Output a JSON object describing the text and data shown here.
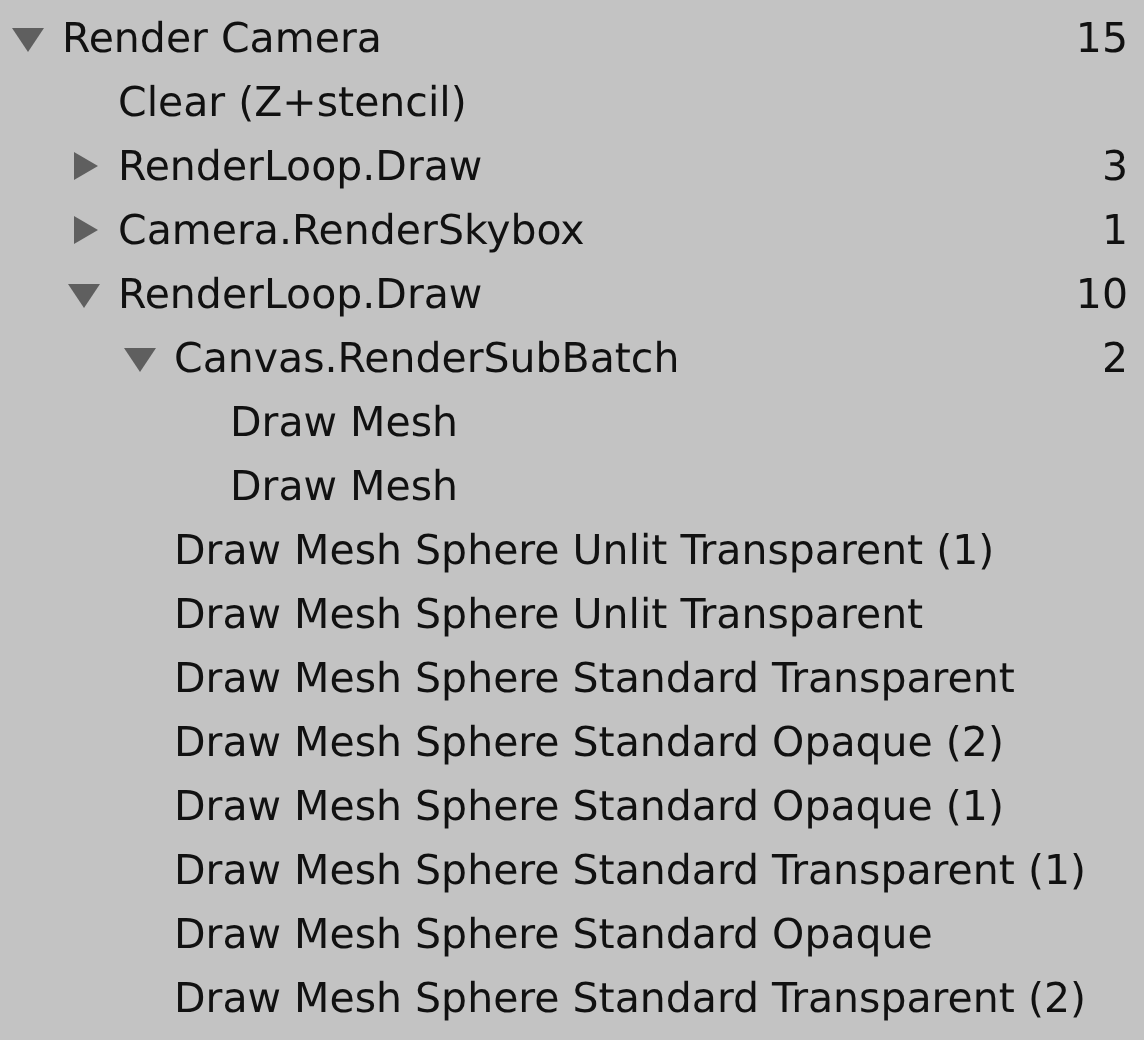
{
  "tree": [
    {
      "label": "Render Camera",
      "count": "15",
      "expanded": true,
      "children": [
        {
          "label": "Clear (Z+stencil)"
        },
        {
          "label": "RenderLoop.Draw",
          "count": "3",
          "expanded": false
        },
        {
          "label": "Camera.RenderSkybox",
          "count": "1",
          "expanded": false
        },
        {
          "label": "RenderLoop.Draw",
          "count": "10",
          "expanded": true,
          "children": [
            {
              "label": "Canvas.RenderSubBatch",
              "count": "2",
              "expanded": true,
              "children": [
                {
                  "label": "Draw Mesh"
                },
                {
                  "label": "Draw Mesh"
                }
              ]
            },
            {
              "label": "Draw Mesh Sphere Unlit Transparent (1)"
            },
            {
              "label": "Draw Mesh Sphere Unlit Transparent"
            },
            {
              "label": "Draw Mesh Sphere Standard Transparent"
            },
            {
              "label": "Draw Mesh Sphere Standard Opaque (2)"
            },
            {
              "label": "Draw Mesh Sphere Standard Opaque (1)"
            },
            {
              "label": "Draw Mesh Sphere Standard Transparent (1)"
            },
            {
              "label": "Draw Mesh Sphere Standard Opaque"
            },
            {
              "label": "Draw Mesh Sphere Standard Transparent (2)"
            }
          ]
        }
      ]
    }
  ]
}
